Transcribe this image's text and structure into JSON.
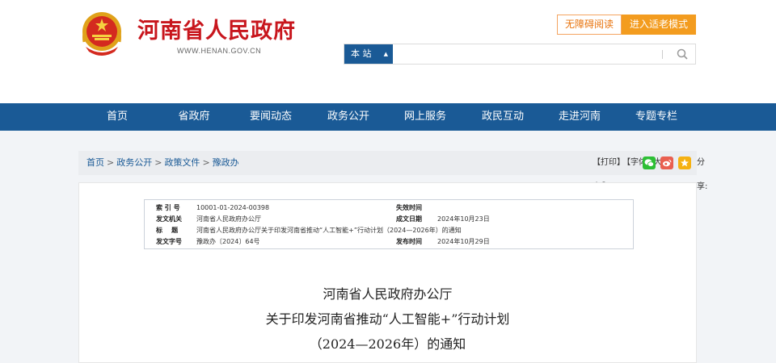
{
  "header": {
    "site_title": "河南省人民政府",
    "site_url": "WWW.HENAN.GOV.CN",
    "accessibility_label": "无障碍阅读",
    "elder_mode_label": "进入适老模式",
    "search_scope": "本 站",
    "search_placeholder": ""
  },
  "nav": {
    "items": [
      {
        "label": "首页"
      },
      {
        "label": "省政府"
      },
      {
        "label": "要闻动态"
      },
      {
        "label": "政务公开"
      },
      {
        "label": "网上服务"
      },
      {
        "label": "政民互动"
      },
      {
        "label": "走进河南"
      },
      {
        "label": "专题专栏"
      }
    ]
  },
  "breadcrumb": {
    "items": [
      "首页",
      "政务公开",
      "政策文件",
      "豫政办"
    ],
    "separator": ">"
  },
  "tools": {
    "print": "【打印】",
    "font_label": "【字体:",
    "font_large": "大",
    "font_medium": "中",
    "font_small": "小",
    "font_close": "】",
    "share_label": "分享:"
  },
  "meta": {
    "index_label": "索 引 号",
    "index_value": "10001-01-2024-00398",
    "expire_label": "失效时间",
    "expire_value": "",
    "issuer_label": "发文机关",
    "issuer_value": "河南省人民政府办公厅",
    "created_label": "成文日期",
    "created_value": "2024年10月23日",
    "title_label": "标    题",
    "title_value": "河南省人民政府办公厅关于印发河南省推动“人工智能+”行动计划（2024—2026年）的通知",
    "docno_label": "发文字号",
    "docno_value": "豫政办〔2024〕64号",
    "published_label": "发布时间",
    "published_value": "2024年10月29日"
  },
  "document": {
    "title_line1": "河南省人民政府办公厅",
    "title_line2": "关于印发河南省推动“人工智能+”行动计划",
    "title_line3": "（2024—2026年）的通知"
  },
  "colors": {
    "brand_red": "#c8161d",
    "nav_blue": "#1a5a96",
    "accent_orange": "#f39c1f",
    "wechat_green": "#2dbf35",
    "weibo_red": "#e95f4f",
    "star_yellow": "#f5b111"
  }
}
